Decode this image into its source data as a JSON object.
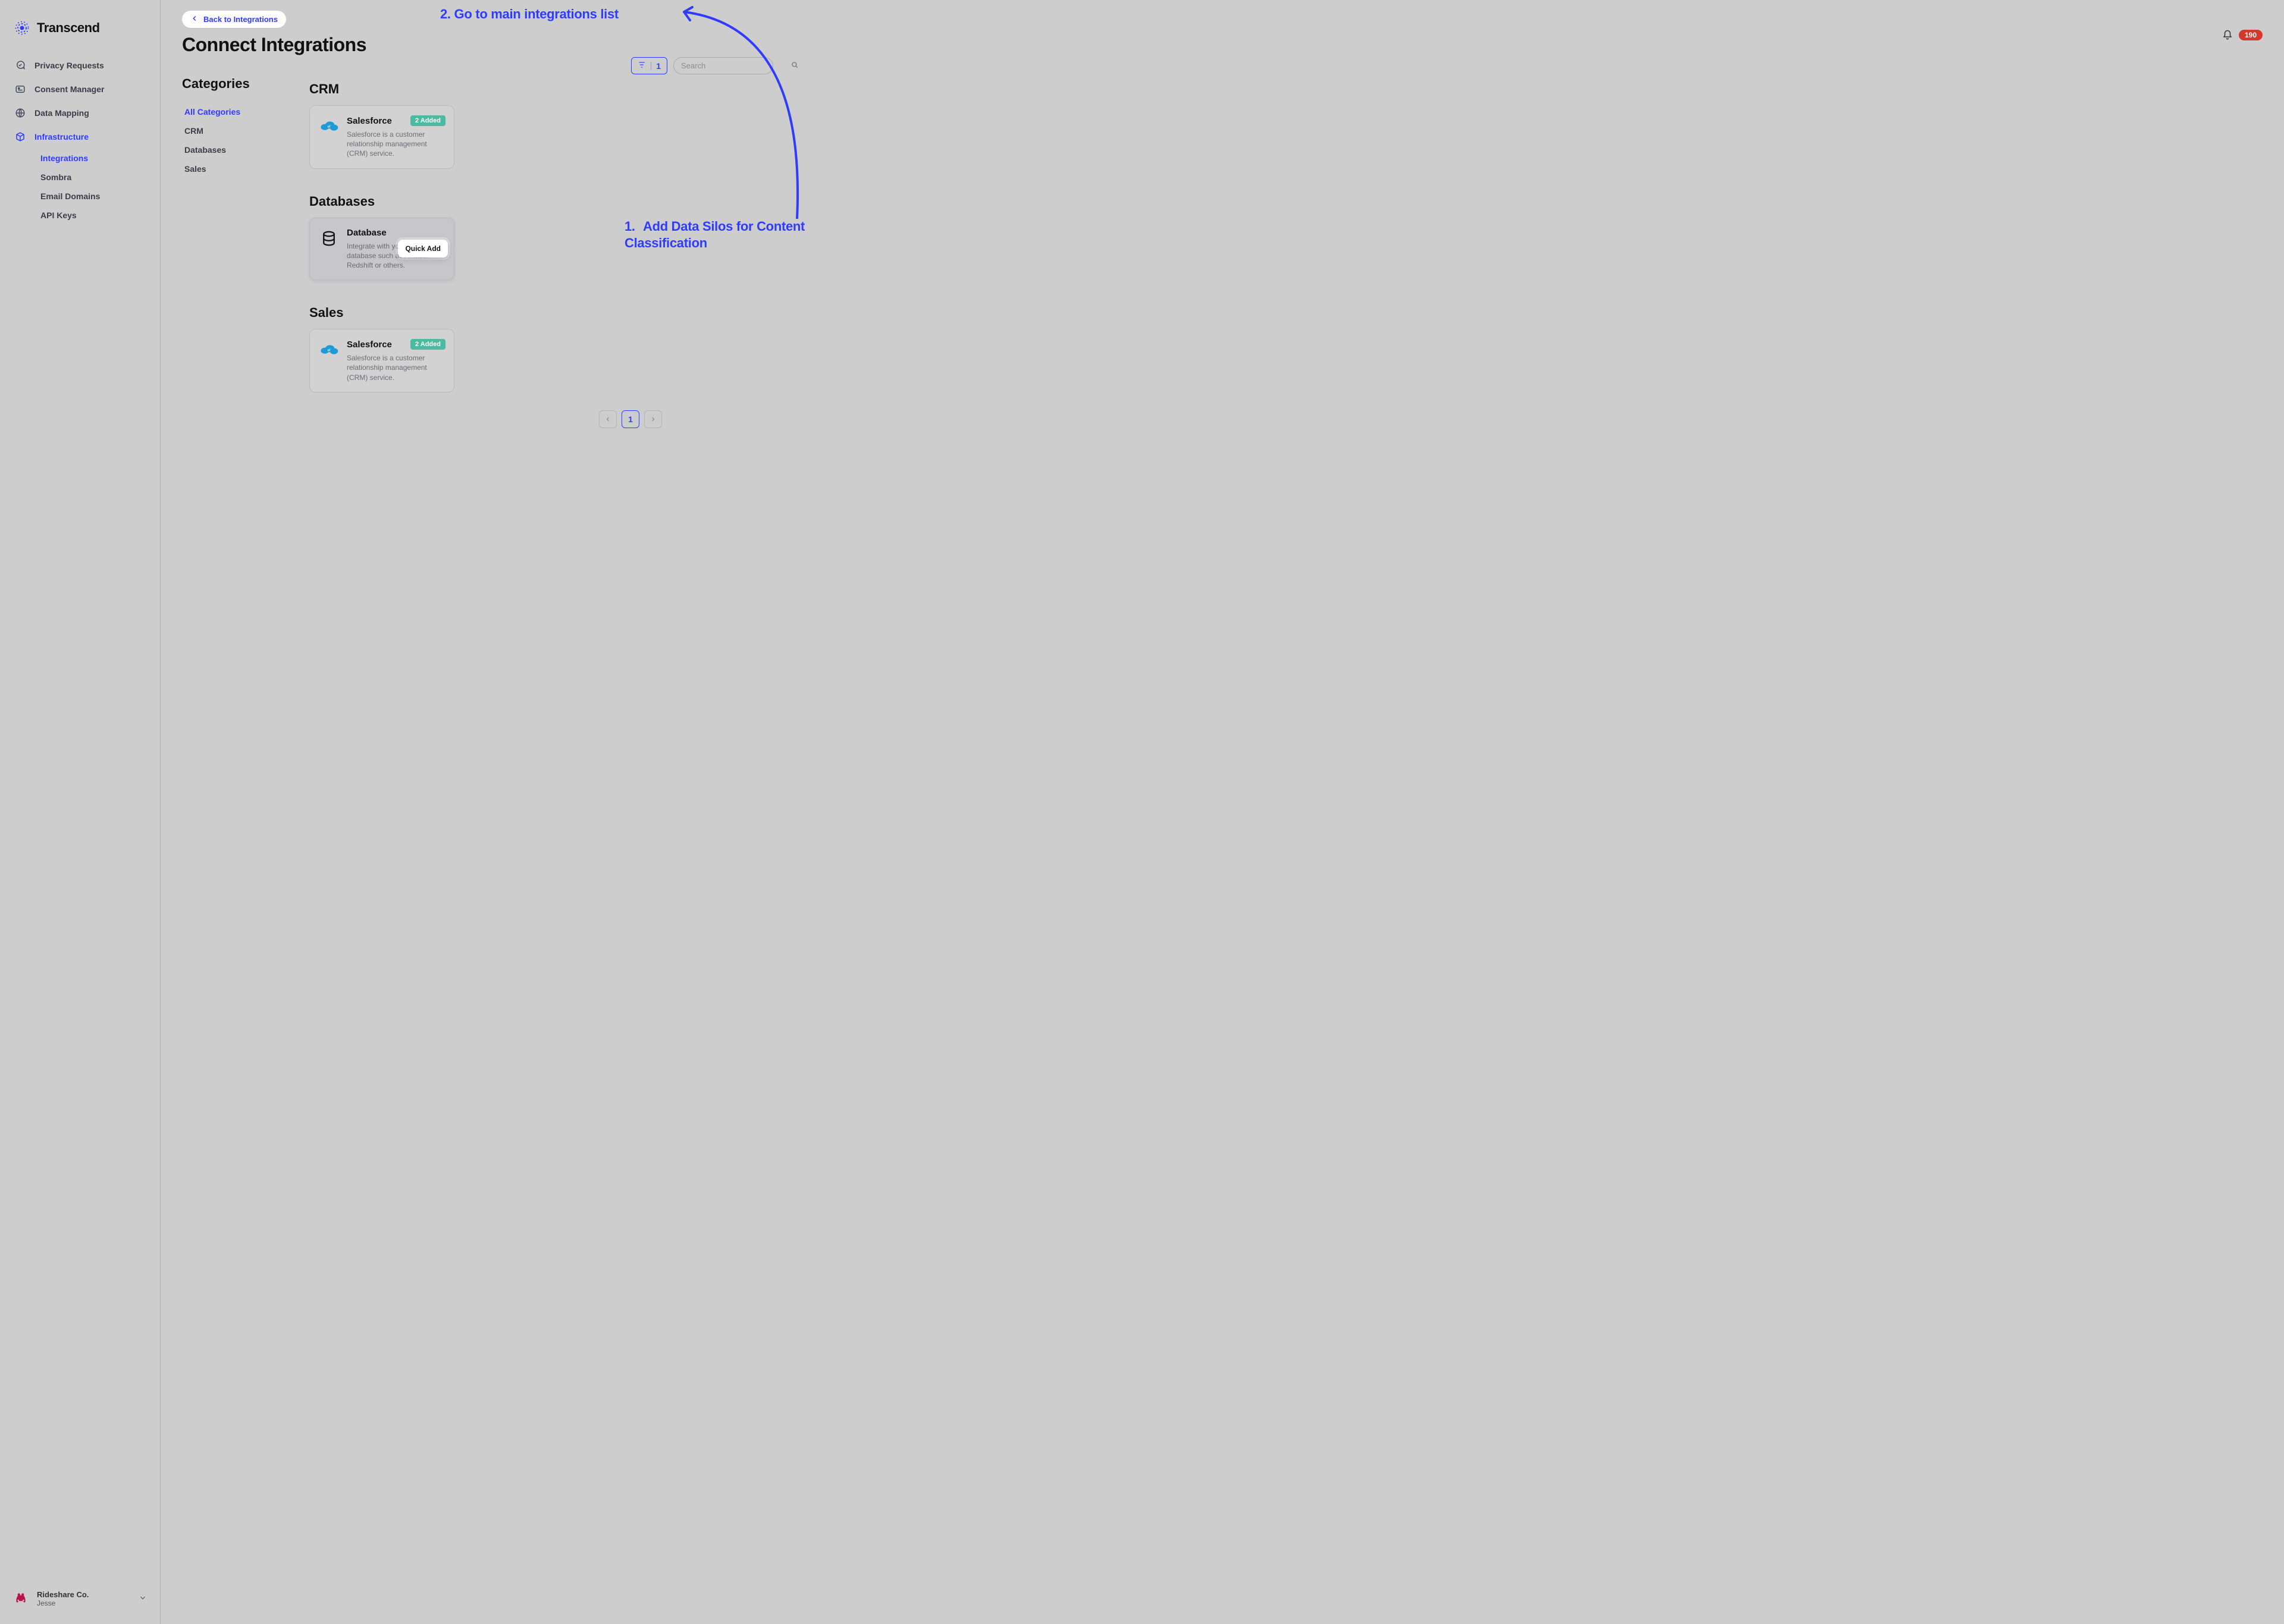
{
  "brand": {
    "name": "Transcend"
  },
  "header": {
    "notification_count": "190"
  },
  "back_link": "Back to Integrations",
  "page_title": "Connect Integrations",
  "sidebar": {
    "items": [
      {
        "label": "Privacy Requests"
      },
      {
        "label": "Consent Manager"
      },
      {
        "label": "Data Mapping"
      },
      {
        "label": "Infrastructure"
      }
    ],
    "sub": [
      {
        "label": "Integrations"
      },
      {
        "label": "Sombra"
      },
      {
        "label": "Email Domains"
      },
      {
        "label": "API Keys"
      }
    ]
  },
  "org": {
    "name": "Rideshare Co.",
    "user": "Jesse"
  },
  "categories": {
    "title": "Categories",
    "items": [
      {
        "label": "All Categories"
      },
      {
        "label": "CRM"
      },
      {
        "label": "Databases"
      },
      {
        "label": "Sales"
      }
    ]
  },
  "filter": {
    "count": "1"
  },
  "search": {
    "placeholder": "Search"
  },
  "sections": {
    "crm": {
      "title": "CRM",
      "card": {
        "title": "Salesforce",
        "badge": "2 Added",
        "desc": "Salesforce is a customer relationship management (CRM) service."
      }
    },
    "databases": {
      "title": "Databases",
      "card": {
        "title": "Database",
        "desc": "Integrate with your own database such as Amazon Redshift or others.",
        "quick_add": "Quick Add"
      }
    },
    "sales": {
      "title": "Sales",
      "card": {
        "title": "Salesforce",
        "badge": "2 Added",
        "desc": "Salesforce is a customer relationship management (CRM) service."
      }
    }
  },
  "pager": {
    "page": "1"
  },
  "annotations": {
    "one_prefix": "1.",
    "one_text": "Add Data Silos for Content Classification",
    "two": "2. Go to main integrations list"
  }
}
